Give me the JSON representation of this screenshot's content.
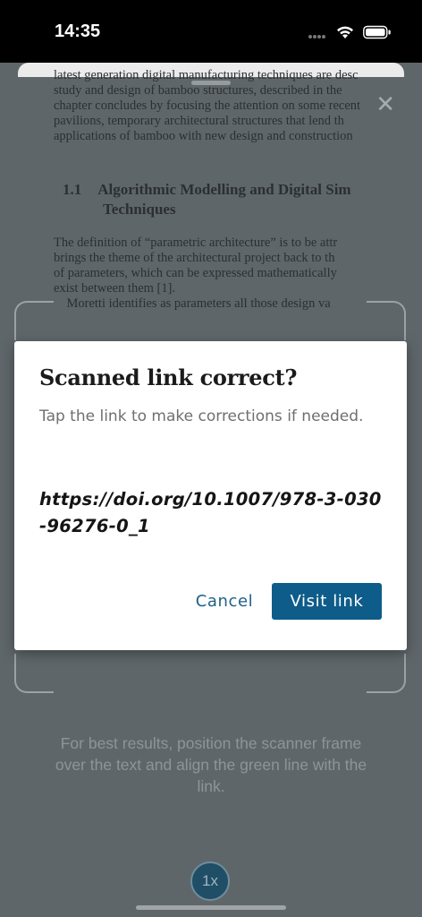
{
  "status_bar": {
    "time": "14:35"
  },
  "document": {
    "lines_top": [
      "latest generation digital manufacturing techniques are desc",
      "study and design of bamboo structures, described in the",
      "chapter concludes by focusing the attention on some recent",
      "pavilions, temporary architectural structures that lend th",
      "applications of bamboo with new design and construction"
    ],
    "heading_number": "1.1",
    "heading_line1": "Algorithmic Modelling and Digital Sim",
    "heading_line2": "Techniques",
    "lines_bottom": [
      "The definition of “parametric architecture” is to be attr",
      "brings the theme of the architectural project back to th",
      "of parameters, which can be expressed mathematically",
      "exist between them [1].",
      "    Moretti identifies as parameters all those design va"
    ]
  },
  "scanner": {
    "hint": "For best results, position the scanner frame over the text and align the green line with the link.",
    "zoom_label": "1x"
  },
  "dialog": {
    "title": "Scanned link correct?",
    "body": "Tap the link to make corrections if needed.",
    "link": "https://doi.org/10.1007/978-3-030-96276-0_1",
    "cancel_label": "Cancel",
    "visit_label": "Visit link"
  },
  "colors": {
    "accent": "#0e5c8a",
    "zoom_button": "#1f4e66",
    "overlay": "#5f666a"
  }
}
